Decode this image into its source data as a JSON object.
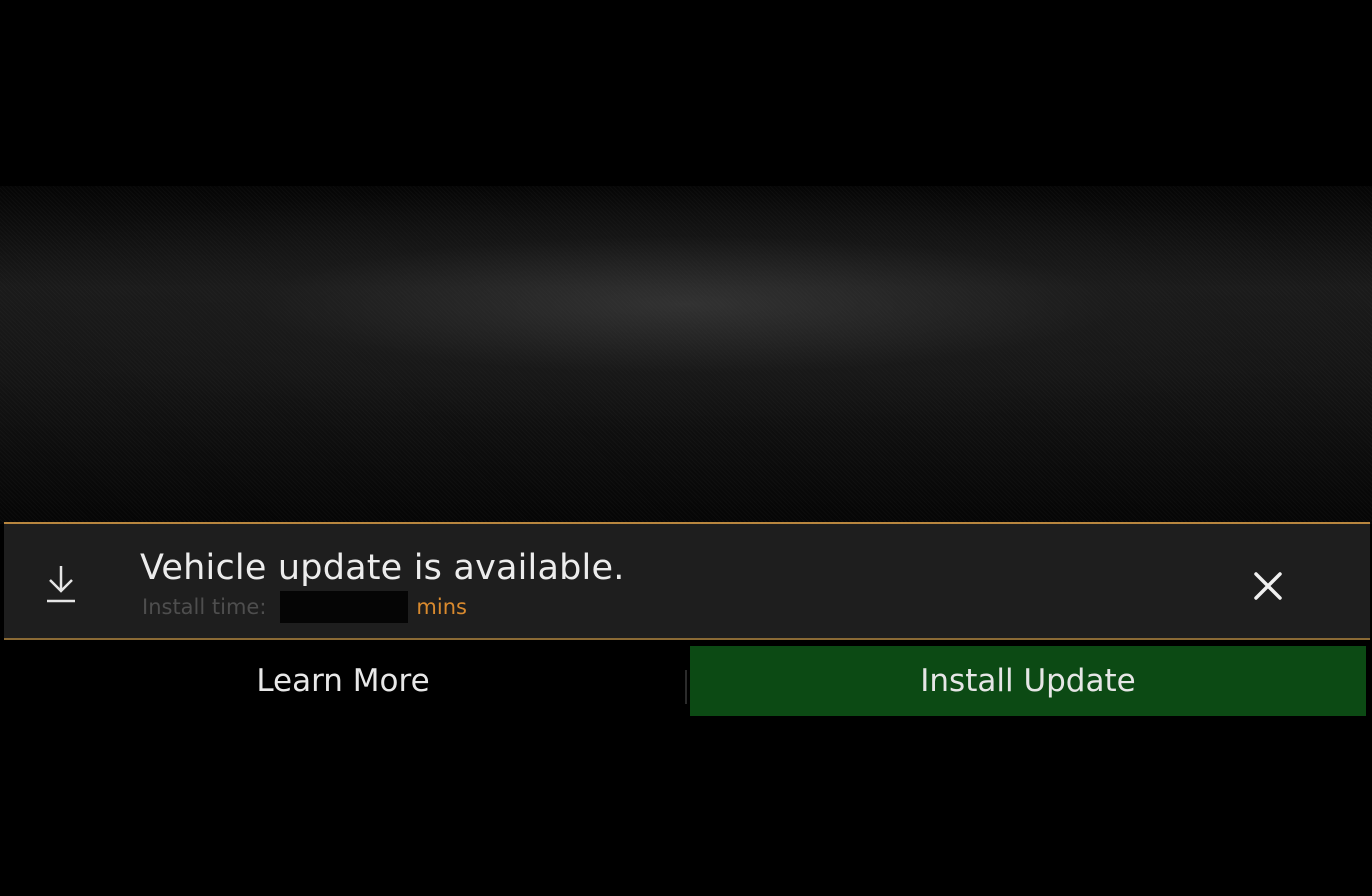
{
  "notification": {
    "icon": "download-icon",
    "title": "Vehicle update is available.",
    "install_time_label": "Install time:",
    "install_time_unit": "mins",
    "close_icon": "close-icon"
  },
  "actions": {
    "learn_more_label": "Learn More",
    "install_update_label": "Install Update"
  },
  "colors": {
    "accent_border": "#b8863f",
    "unit_text": "#d98a2e",
    "install_button": "#0c4a14",
    "banner_background": "#1e1e1e"
  }
}
